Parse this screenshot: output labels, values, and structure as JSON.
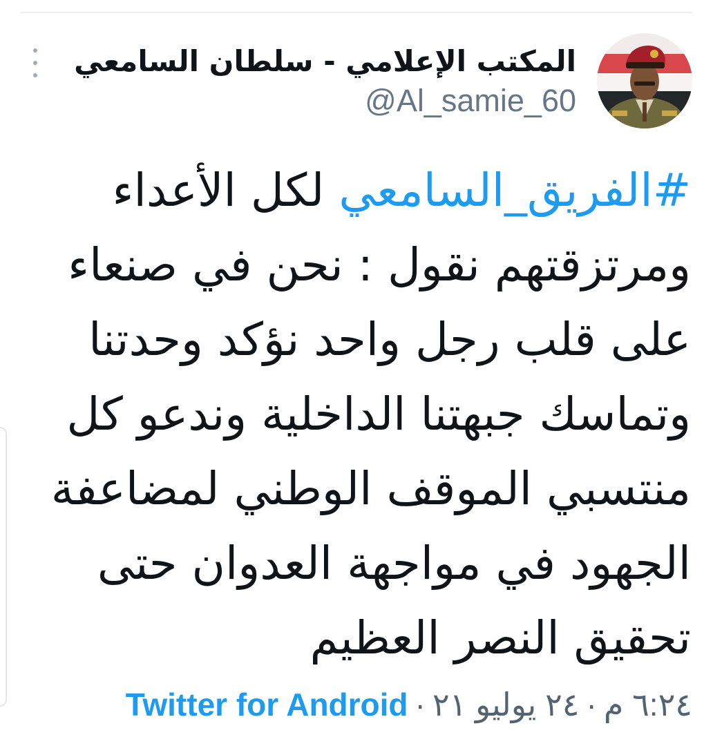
{
  "author": {
    "display_name": "المكتب الإعلامي - سلطان السامعي",
    "handle": "@Al_samie_60",
    "avatar_icon": "profile-photo-icon"
  },
  "tweet": {
    "hashtag": "#الفريق_السامعي",
    "lines": [
      " لكل الأعداء",
      "ومرتزقتهم نقول : نحن في صنعاء",
      "على قلب رجل واحد نؤكد وحدتنا",
      "وتماسك جبهتنا الداخلية  وندعو كل",
      "منتسبي الموقف الوطني لمضاعفة",
      "الجهود  في مواجهة العدوان حتى",
      "تحقيق النصر العظيم"
    ]
  },
  "meta": {
    "time": "٦:٢٤ م",
    "separator": "·",
    "date": "٢٤ يوليو ٢١",
    "source": "Twitter for Android"
  },
  "colors": {
    "link": "#1d9bf0",
    "secondary_text": "#657786",
    "primary_text": "#0f1419"
  },
  "icons": {
    "more": "more-vertical-icon"
  }
}
